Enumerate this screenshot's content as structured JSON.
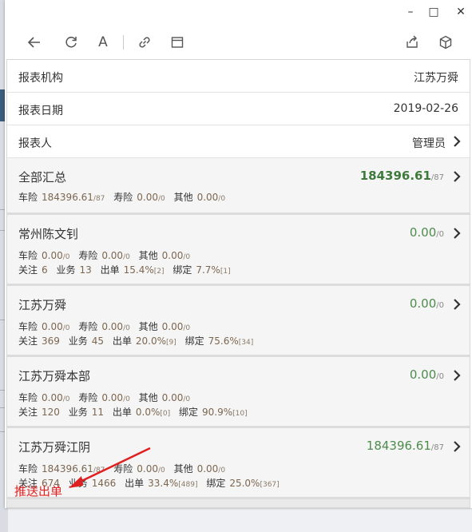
{
  "window": {
    "min_label": "–",
    "max_label": "□",
    "close_label": "✕"
  },
  "toolbar": {
    "icons": [
      "back-icon",
      "refresh-icon",
      "font-icon",
      "link-icon",
      "window-icon",
      "share-icon",
      "cube-icon"
    ],
    "font_glyph": "A"
  },
  "info": {
    "org_label": "报表机构",
    "org_value": "江苏万舜",
    "date_label": "报表日期",
    "date_value": "2019-02-26",
    "reporter_label": "报表人",
    "reporter_value": "管理员"
  },
  "summary": {
    "name": "全部汇总",
    "amount": "184396.61",
    "amount_sub": "/87",
    "line1": {
      "k1": "车险",
      "v1": "184396.61",
      "s1": "/87",
      "k2": "寿险",
      "v2": "0.00",
      "s2": "/0",
      "k3": "其他",
      "v3": "0.00",
      "s3": "/0"
    }
  },
  "cards": [
    {
      "name": "常州陈文钊",
      "amount": "0.00",
      "amount_sub": "/0",
      "line1": {
        "k1": "车险",
        "v1": "0.00",
        "s1": "/0",
        "k2": "寿险",
        "v2": "0.00",
        "s2": "/0",
        "k3": "其他",
        "v3": "0.00",
        "s3": "/0"
      },
      "line2": {
        "k1": "关注",
        "v1": "6",
        "k2": "业务",
        "v2": "13",
        "k3": "出单",
        "v3": "15.4%",
        "s3": "[2]",
        "k4": "绑定",
        "v4": "7.7%",
        "s4": "[1]"
      }
    },
    {
      "name": "江苏万舜",
      "amount": "0.00",
      "amount_sub": "/0",
      "line1": {
        "k1": "车险",
        "v1": "0.00",
        "s1": "/0",
        "k2": "寿险",
        "v2": "0.00",
        "s2": "/0",
        "k3": "其他",
        "v3": "0.00",
        "s3": "/0"
      },
      "line2": {
        "k1": "关注",
        "v1": "369",
        "k2": "业务",
        "v2": "45",
        "k3": "出单",
        "v3": "20.0%",
        "s3": "[9]",
        "k4": "绑定",
        "v4": "75.6%",
        "s4": "[34]"
      }
    },
    {
      "name": "江苏万舜本部",
      "amount": "0.00",
      "amount_sub": "/0",
      "line1": {
        "k1": "车险",
        "v1": "0.00",
        "s1": "/0",
        "k2": "寿险",
        "v2": "0.00",
        "s2": "/0",
        "k3": "其他",
        "v3": "0.00",
        "s3": "/0"
      },
      "line2": {
        "k1": "关注",
        "v1": "120",
        "k2": "业务",
        "v2": "11",
        "k3": "出单",
        "v3": "0.0%",
        "s3": "[0]",
        "k4": "绑定",
        "v4": "90.9%",
        "s4": "[10]"
      }
    },
    {
      "name": "江苏万舜江阴",
      "amount": "184396.61",
      "amount_sub": "/87",
      "line1": {
        "k1": "车险",
        "v1": "184396.61",
        "s1": "/87",
        "k2": "寿险",
        "v2": "0.00",
        "s2": "/0",
        "k3": "其他",
        "v3": "0.00",
        "s3": "/0"
      },
      "line2": {
        "k1": "关注",
        "v1": "674",
        "k2": "业务",
        "v2": "1466",
        "k3": "出单",
        "v3": "33.4%",
        "s3": "[489]",
        "k4": "绑定",
        "v4": "25.0%",
        "s4": "[367]"
      }
    }
  ],
  "annotation": {
    "text": "推送出单",
    "color": "#e02020"
  },
  "colors": {
    "amount_green": "#4e8c4c",
    "value_brown": "#7c6650"
  }
}
